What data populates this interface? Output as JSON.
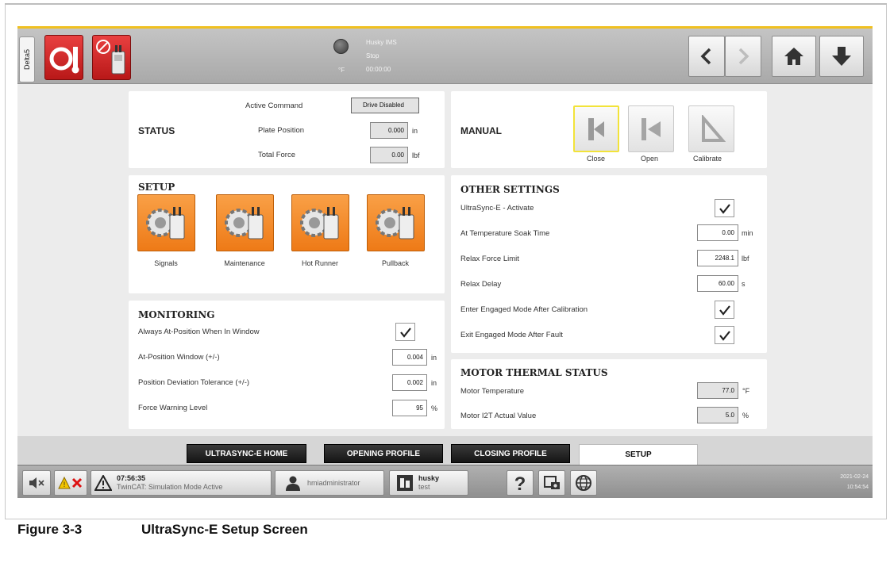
{
  "colors": {
    "accent_gold": "#f0c020",
    "alarm_red": "#d42a2a",
    "setup_orange": "#f08a25",
    "panel_bg": "#ffffff",
    "screen_bg": "#ececec",
    "tab_dark": "#1e1e1e"
  },
  "topbar": {
    "machine_tab": "Delta5",
    "system_name": "Husky IMS",
    "system_state": "Stop",
    "system_timer": "00:00:00",
    "lamp_unit": "°F",
    "icons": [
      "heater-alarm-icon",
      "ultrasync-disabled-icon",
      "back-arrow-icon",
      "forward-arrow-icon",
      "home-icon",
      "download-arrow-icon"
    ]
  },
  "status": {
    "title": "STATUS",
    "active_command_label": "Active Command",
    "active_command_value": "Drive Disabled",
    "plate_position_label": "Plate Position",
    "plate_position_value": "0.000",
    "plate_position_unit": "in",
    "total_force_label": "Total Force",
    "total_force_value": "0.00",
    "total_force_unit": "lbf"
  },
  "manual": {
    "title": "MANUAL",
    "close_label": "Close",
    "open_label": "Open",
    "calibrate_label": "Calibrate"
  },
  "setup": {
    "title": "SETUP",
    "tiles": [
      {
        "label": "Signals"
      },
      {
        "label": "Maintenance"
      },
      {
        "label": "Hot Runner"
      },
      {
        "label": "Pullback"
      }
    ]
  },
  "monitoring": {
    "title": "MONITORING",
    "always_at_position_label": "Always At-Position When In Window",
    "always_at_position_checked": true,
    "at_position_window_label": "At-Position Window (+/-)",
    "at_position_window_value": "0.004",
    "at_position_window_unit": "in",
    "deviation_tolerance_label": "Position Deviation Tolerance (+/-)",
    "deviation_tolerance_value": "0.002",
    "deviation_tolerance_unit": "in",
    "force_warning_label": "Force Warning Level",
    "force_warning_value": "95",
    "force_warning_unit": "%"
  },
  "other_settings": {
    "title": "OTHER SETTINGS",
    "activate_label": "UltraSync-E - Activate",
    "activate_checked": true,
    "soak_time_label": "At Temperature Soak Time",
    "soak_time_value": "0.00",
    "soak_time_unit": "min",
    "relax_force_label": "Relax Force Limit",
    "relax_force_value": "2248.1",
    "relax_force_unit": "lbf",
    "relax_delay_label": "Relax Delay",
    "relax_delay_value": "60.00",
    "relax_delay_unit": "s",
    "engaged_after_cal_label": "Enter Engaged Mode After Calibration",
    "engaged_after_cal_checked": true,
    "exit_engaged_label": "Exit Engaged Mode After Fault",
    "exit_engaged_checked": true
  },
  "motor": {
    "title": "MOTOR THERMAL STATUS",
    "temperature_label": "Motor Temperature",
    "temperature_value": "77.0",
    "temperature_unit": "°F",
    "i2t_label": "Motor I2T Actual Value",
    "i2t_value": "5.0",
    "i2t_unit": "%"
  },
  "tabs": [
    {
      "label": "ULTRASYNC-E HOME",
      "active": false
    },
    {
      "label": "OPENING PROFILE",
      "active": false
    },
    {
      "label": "CLOSING PROFILE",
      "active": false
    },
    {
      "label": "SETUP",
      "active": true
    }
  ],
  "footer": {
    "alarm_time": "07:56:35",
    "alarm_message": "TwinCAT: Simulation Mode Active",
    "user_name": "hmiadministrator",
    "mold_name": "husky",
    "mold_sub": "test",
    "date": "2021-02-24",
    "time": "10:54:54"
  },
  "caption": {
    "number": "Figure 3-3",
    "title": "UltraSync-E Setup Screen"
  }
}
